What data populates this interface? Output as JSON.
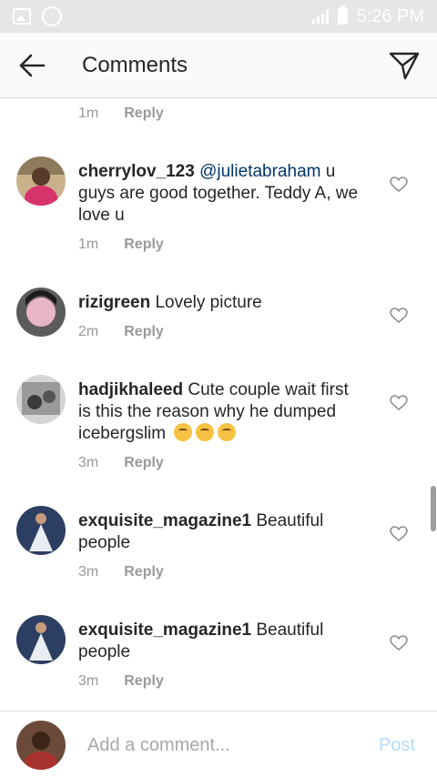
{
  "status_bar": {
    "time": "5:26 PM"
  },
  "header": {
    "title": "Comments"
  },
  "top_partial": {
    "time": "1m",
    "reply": "Reply"
  },
  "comments": [
    {
      "username": "cherrylov_123",
      "mention": "@julietabraham",
      "text": "u guys are good together. Teddy A, we love u",
      "time": "1m",
      "reply": "Reply"
    },
    {
      "username": "rizigreen",
      "text": "Lovely picture",
      "time": "2m",
      "reply": "Reply"
    },
    {
      "username": "hadjikhaleed",
      "text": "Cute couple wait first is this the reason why he dumped icebergslim",
      "time": "3m",
      "reply": "Reply"
    },
    {
      "username": "exquisite_magazine1",
      "text": "Beautiful people",
      "time": "3m",
      "reply": "Reply"
    },
    {
      "username": "exquisite_magazine1",
      "text": "Beautiful people",
      "time": "3m",
      "reply": "Reply"
    }
  ],
  "composer": {
    "placeholder": "Add a comment...",
    "post_label": "Post"
  },
  "colors": {
    "mention": "#003569",
    "post_disabled": "#b3dbff",
    "meta": "#999999"
  }
}
